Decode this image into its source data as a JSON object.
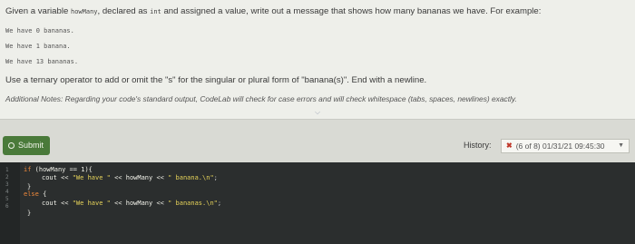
{
  "prompt": {
    "line1_a": "Given a variable ",
    "line1_var": "howMany",
    "line1_b": ", declared as ",
    "line1_type": "int",
    "line1_c": " and assigned a value, write out a message that shows how many bananas we have. For example:",
    "samples": [
      "We have 0 bananas.",
      "We have 1 banana.",
      "We have 13 bananas."
    ],
    "line2": "Use a ternary operator to add or omit the \"s\" for the singular or plural form of \"banana(s)\". End with a newline.",
    "notes": "Additional Notes: Regarding your code's standard output, CodeLab will check for case errors and will check whitespace (tabs, spaces, newlines) exactly."
  },
  "toolbar": {
    "submit_label": "Submit",
    "history_label": "History:",
    "history_value": "(6 of 8) 01/31/21 09:45:30"
  },
  "icons": {
    "submit": "circle-icon",
    "history_status": "x-mark-icon",
    "history_caret": "dropdown-caret-icon",
    "expand": "chevron-down-icon"
  },
  "colors": {
    "submit_bg": "#4a7a3a",
    "editor_bg": "#2b2e2e",
    "keyword": "#f08a3c",
    "string": "#e6d35a",
    "error": "#c0392b"
  },
  "editor": {
    "line_numbers": [
      "1",
      "2",
      "3",
      "4",
      "5",
      "6"
    ],
    "line1": {
      "kw": "if",
      "rest": " (howMany == 1){"
    },
    "line2": {
      "a": "cout << ",
      "s1": "\"We have \"",
      "b": " << howMany << ",
      "s2": "\" banana.\\n\"",
      "c": ";"
    },
    "line3": "}",
    "line4": {
      "kw": "else",
      "rest": " {"
    },
    "line5": {
      "a": "cout << ",
      "s1": "\"We have \"",
      "b": " << howMany << ",
      "s2": "\" bananas.\\n\"",
      "c": ";"
    },
    "line6": "}"
  }
}
